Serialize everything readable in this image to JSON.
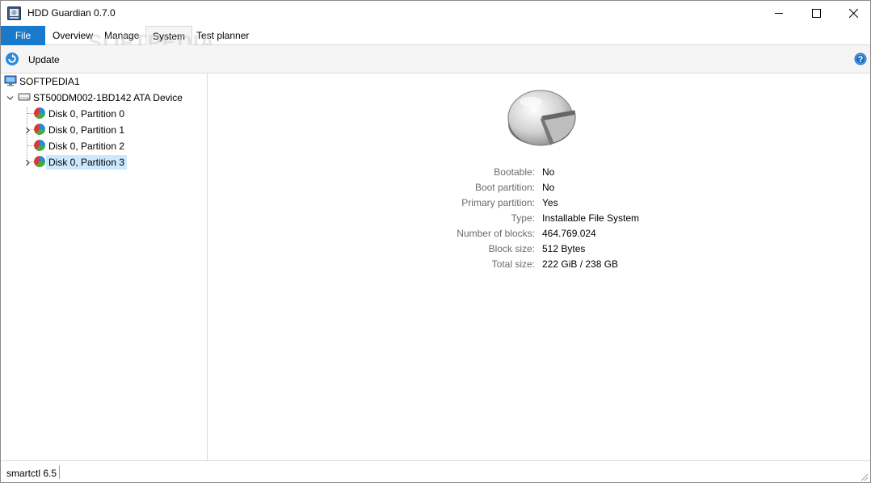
{
  "window": {
    "title": "HDD Guardian 0.7.0"
  },
  "menu": {
    "file": "File",
    "tabs": [
      {
        "label": "Overview"
      },
      {
        "label": "Manage"
      },
      {
        "label": "System"
      },
      {
        "label": "Test planner"
      }
    ]
  },
  "watermark": "SOFTPEDIA",
  "toolbar": {
    "update_label": "Update",
    "update_icon": "refresh-icon",
    "help_icon": "help-icon"
  },
  "tree": {
    "computer": "SOFTPEDIA1",
    "device": "ST500DM002-1BD142 ATA Device",
    "partitions": [
      {
        "label": "Disk 0, Partition 0",
        "expandable": false,
        "selected": false
      },
      {
        "label": "Disk 0, Partition 1",
        "expandable": true,
        "selected": false
      },
      {
        "label": "Disk 0, Partition 2",
        "expandable": false,
        "selected": false
      },
      {
        "label": "Disk 0, Partition 3",
        "expandable": true,
        "selected": true
      }
    ]
  },
  "details": {
    "properties": [
      {
        "key": "Bootable:",
        "value": "No"
      },
      {
        "key": "Boot partition:",
        "value": "No"
      },
      {
        "key": "Primary partition:",
        "value": "Yes"
      },
      {
        "key": "Type:",
        "value": "Installable File System"
      },
      {
        "key": "Number of blocks:",
        "value": "464.769.024"
      },
      {
        "key": "Block size:",
        "value": "512 Bytes"
      },
      {
        "key": "Total size:",
        "value": "222 GiB / 238 GB"
      }
    ]
  },
  "status": {
    "text": "smartctl 6.5"
  },
  "colors": {
    "accent": "#1979ca",
    "selection": "#cce8ff",
    "toolbar_bg": "#f5f5f5"
  }
}
